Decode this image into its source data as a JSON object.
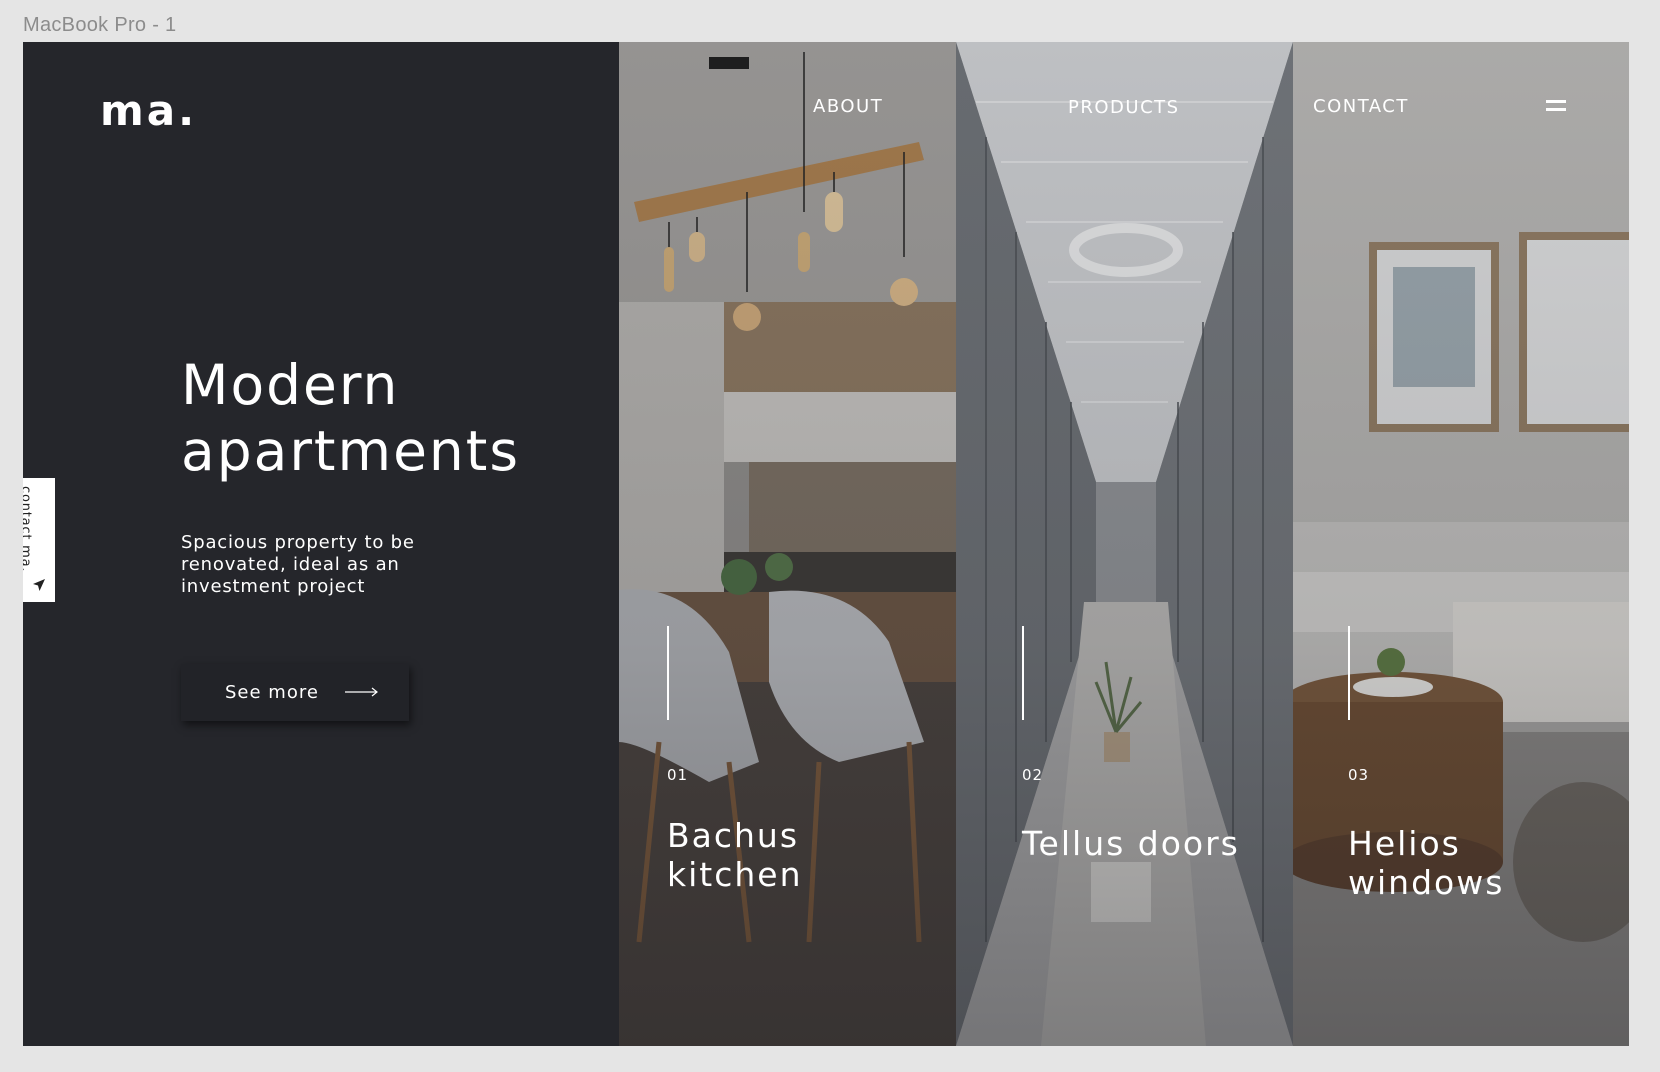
{
  "frame_label": "MacBook Pro - 1",
  "logo": "ma.",
  "nav": {
    "about": "ABOUT",
    "products": "PRODUCTS",
    "contact": "CONTACT",
    "menu_icon": "hamburger-icon"
  },
  "hero": {
    "title": "Modern apartments",
    "subtitle": "Spacious property to be renovated, ideal as an investment project",
    "cta_label": "See more",
    "cta_icon": "long-arrow-right-icon"
  },
  "side_tab": {
    "label": "contact ma.",
    "icon": "navigation-arrow-icon"
  },
  "panels": [
    {
      "number": "01",
      "title": "Bachus kitchen"
    },
    {
      "number": "02",
      "title": "Tellus doors"
    },
    {
      "number": "03",
      "title": "Helios windows"
    }
  ],
  "colors": {
    "dark_background": "#25262b",
    "text": "#ffffff",
    "canvas": "#e5e5e5"
  }
}
